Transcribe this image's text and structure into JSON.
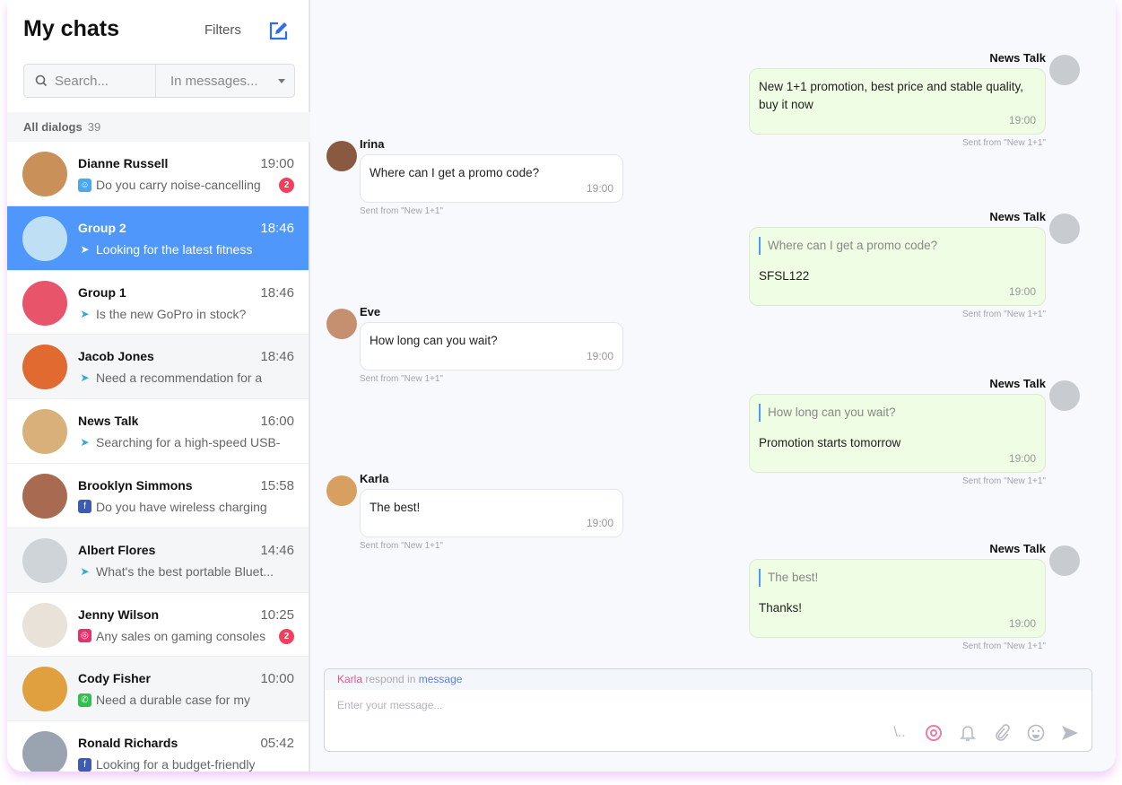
{
  "sidebar": {
    "title": "My chats",
    "filters_label": "Filters",
    "search_placeholder": "Search...",
    "search_scope": "In messages...",
    "all_dialogs_label": "All dialogs",
    "all_dialogs_count": "39",
    "chats": [
      {
        "name": "Dianne Russell",
        "time": "19:00",
        "preview": "Do you carry noise-cancelling",
        "channel": "bot",
        "unread": "2"
      },
      {
        "name": "Group 2",
        "time": "18:46",
        "preview": "Looking for the latest fitness",
        "channel": "telegram",
        "selected": true
      },
      {
        "name": "Group 1",
        "time": "18:46",
        "preview": "Is the new GoPro in stock?",
        "channel": "telegram"
      },
      {
        "name": "Jacob Jones",
        "time": "18:46",
        "preview": "Need a recommendation for a",
        "channel": "telegram"
      },
      {
        "name": "News Talk",
        "time": "16:00",
        "preview": "Searching for a high-speed USB-",
        "channel": "telegram"
      },
      {
        "name": "Brooklyn Simmons",
        "time": "15:58",
        "preview": "Do you have wireless charging",
        "channel": "facebook"
      },
      {
        "name": "Albert Flores",
        "time": "14:46",
        "preview": "What's the best portable Bluet...",
        "channel": "telegram"
      },
      {
        "name": "Jenny Wilson",
        "time": "10:25",
        "preview": "Any sales on gaming consoles",
        "channel": "instagram",
        "unread": "2"
      },
      {
        "name": "Cody Fisher",
        "time": "10:00",
        "preview": "Need a durable case for my",
        "channel": "whatsapp"
      },
      {
        "name": "Ronald Richards",
        "time": "05:42",
        "preview": "Looking for a budget-friendly",
        "channel": "facebook"
      }
    ]
  },
  "messages": [
    {
      "sender": "News Talk",
      "dir": "out",
      "text": "New 1+1 promotion, best price and stable quality, buy it now",
      "time": "19:00",
      "sent": "Sent from \"New 1+1\""
    },
    {
      "sender": "Irina",
      "dir": "in",
      "text": "Where can I get a promo code?",
      "time": "19:00",
      "sent": "Sent from \"New 1+1\""
    },
    {
      "sender": "News Talk",
      "dir": "out",
      "quote": "Where can I get a promo code?",
      "text": "SFSL122",
      "time": "19:00",
      "sent": "Sent from \"New 1+1\""
    },
    {
      "sender": "Eve",
      "dir": "in",
      "text": "How long can you wait?",
      "time": "19:00",
      "sent": "Sent from \"New 1+1\""
    },
    {
      "sender": "News Talk",
      "dir": "out",
      "quote": "How long can you wait?",
      "text": "Promotion starts tomorrow",
      "time": "19:00",
      "sent": "Sent from \"New 1+1\""
    },
    {
      "sender": "Karla",
      "dir": "in",
      "text": "The best!",
      "time": "19:00",
      "sent": "Sent from \"New 1+1\""
    },
    {
      "sender": "News Talk",
      "dir": "out",
      "quote": "The best!",
      "text": "Thanks!",
      "time": "19:00",
      "sent": "Sent from \"New 1+1\""
    }
  ],
  "composer": {
    "reply_name": "Karla",
    "reply_mid": " respond in ",
    "reply_target": "message",
    "placeholder": "Enter your message...",
    "tools": [
      "slash-command",
      "eye",
      "bell",
      "paperclip",
      "emoji",
      "send"
    ]
  },
  "colors": {
    "accent": "#4f97fb",
    "badge": "#f0405e",
    "out_bubble": "#eefde3"
  }
}
